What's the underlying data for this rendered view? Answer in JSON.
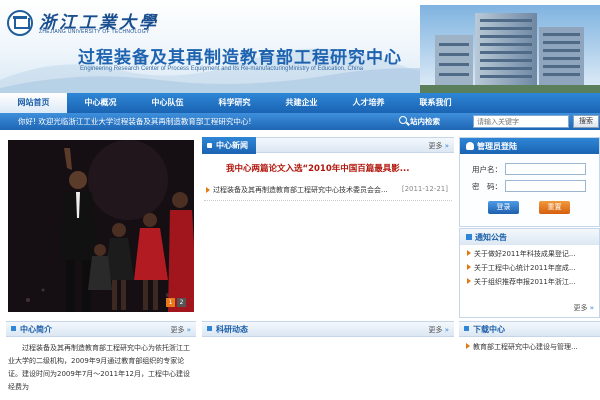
{
  "header": {
    "university_cn": "浙江工業大學",
    "university_en": "ZHEJIANG UNIVERSITY OF TECHNOLOGY",
    "center_cn": "过程装备及其再制造教育部工程研究中心",
    "center_en": "Engineering Research Center of Process Equipment and Its Re-manufacturingMinistry of Education, China"
  },
  "nav": {
    "items": [
      "网站首页",
      "中心概况",
      "中心队伍",
      "科学研究",
      "共建企业",
      "人才培养",
      "联系我们"
    ]
  },
  "welcome": {
    "text": "你好! 欢迎光临浙江工业大学过程装备及其再制造教育部工程研究中心!",
    "search_label": "站内检索",
    "search_placeholder": "请输入关键字",
    "search_button": "搜索"
  },
  "photo": {
    "pager": [
      "1",
      "2"
    ]
  },
  "news": {
    "title": "中心新闻",
    "more": "更多",
    "headline": "我中心两篇论文入选“2010年中国百篇最具影...",
    "items": [
      {
        "title": "过程装备及其再制造教育部工程研究中心技术委员会会...",
        "date": "[2011-12-21]"
      }
    ]
  },
  "login": {
    "title": "管理员登陆",
    "username_label": "用户名：",
    "password_label": "密　码：",
    "login_button": "登录",
    "reset_button": "重置"
  },
  "notice": {
    "title": "通知公告",
    "items": [
      "关于做好2011年科技成果登记...",
      "关于工程中心统计2011年度成...",
      "关于组织推荐申报2011年浙江..."
    ],
    "more": "更多"
  },
  "intro": {
    "title": "中心简介",
    "more": "更多",
    "text": "过程装备及其再制造教育部工程研究中心为依托浙江工业大学的二级机构，2009年9月通过教育部组织的专家论证。建设时间为2009年7月～2011年12月，工程中心建设经费为"
  },
  "research": {
    "title": "科研动态",
    "more": "更多"
  },
  "download": {
    "title": "下载中心",
    "items": [
      "教育部工程研究中心建设与管理..."
    ]
  }
}
